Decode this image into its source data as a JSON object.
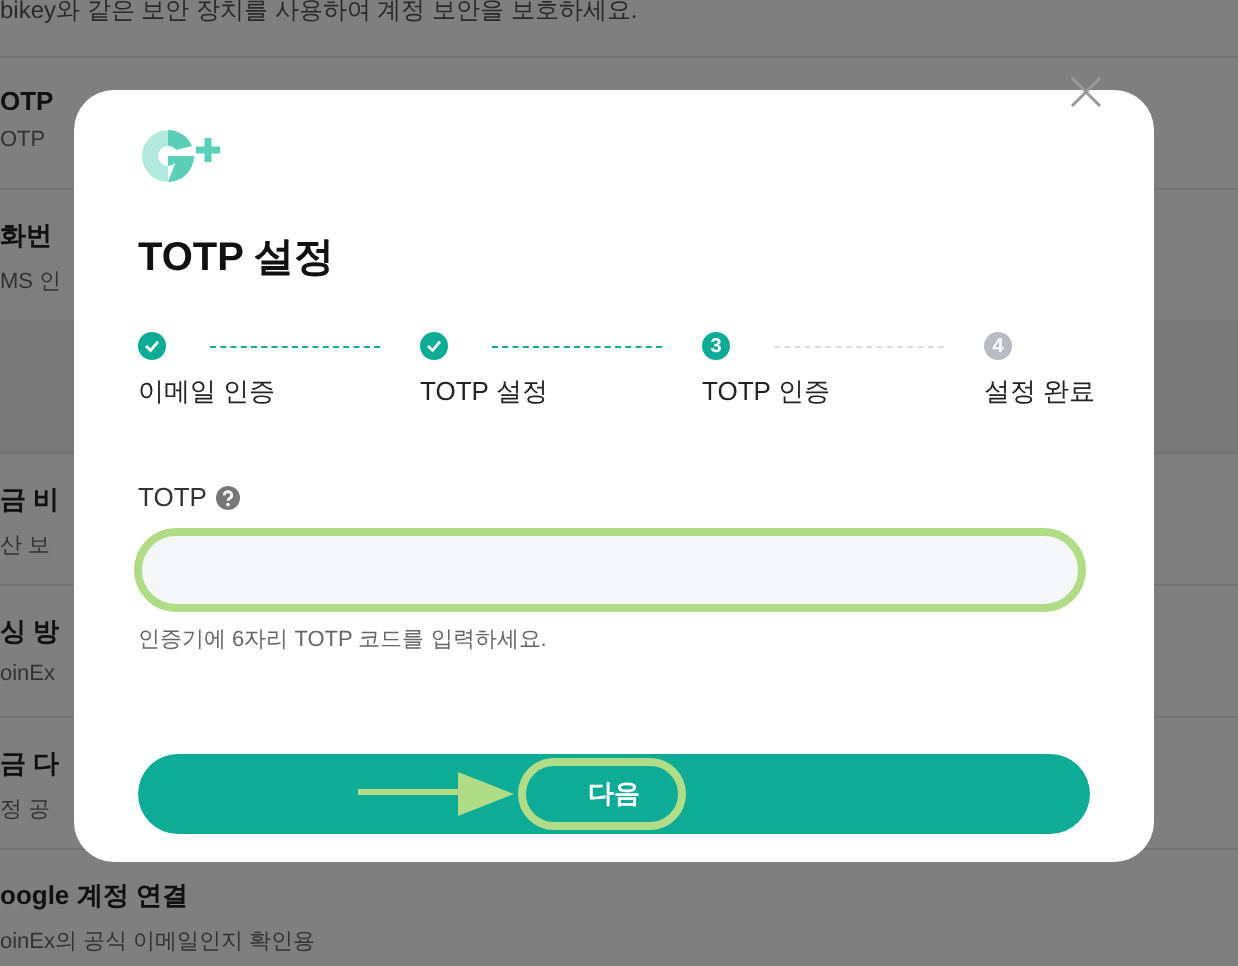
{
  "background": {
    "intro": "bikey와 같은 보안 장치를 사용하여 계정 보안을 보호하세요.",
    "rows": [
      {
        "title": "OTP",
        "description": "OTP"
      },
      {
        "title": "화번",
        "description": "MS 인"
      },
      {
        "kind": "gap"
      },
      {
        "title": "금 비",
        "description": "산 보"
      },
      {
        "title": "싱 방",
        "description": "oinEx"
      },
      {
        "title": "금 다",
        "description": "정 공"
      },
      {
        "title": "oogle 계정 연결",
        "description": "oinEx의 공식 이메일인지 확인용"
      }
    ]
  },
  "dialog": {
    "title": "TOTP 설정",
    "steps": [
      {
        "label": "이메일 인증",
        "kind": "done"
      },
      {
        "label": "TOTP 설정",
        "kind": "done"
      },
      {
        "label": "TOTP 인증",
        "kind": "current",
        "number": "3"
      },
      {
        "label": "설정 완료",
        "kind": "pending",
        "number": "4"
      }
    ],
    "field": {
      "label": "TOTP",
      "hint": "인증기에 6자리 TOTP 코드를 입력하세요.",
      "highlighted": true
    },
    "button": {
      "label": "다음",
      "highlighted": true
    }
  }
}
